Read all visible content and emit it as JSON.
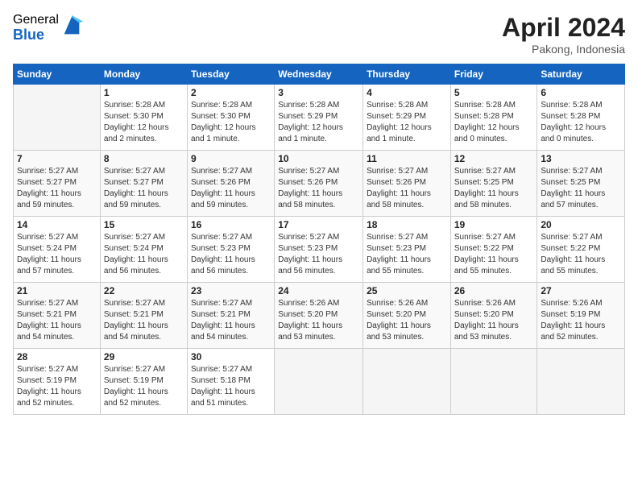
{
  "header": {
    "logo_general": "General",
    "logo_blue": "Blue",
    "month_title": "April 2024",
    "location": "Pakong, Indonesia"
  },
  "days_of_week": [
    "Sunday",
    "Monday",
    "Tuesday",
    "Wednesday",
    "Thursday",
    "Friday",
    "Saturday"
  ],
  "weeks": [
    [
      {
        "day": "",
        "info": ""
      },
      {
        "day": "1",
        "info": "Sunrise: 5:28 AM\nSunset: 5:30 PM\nDaylight: 12 hours\nand 2 minutes."
      },
      {
        "day": "2",
        "info": "Sunrise: 5:28 AM\nSunset: 5:30 PM\nDaylight: 12 hours\nand 1 minute."
      },
      {
        "day": "3",
        "info": "Sunrise: 5:28 AM\nSunset: 5:29 PM\nDaylight: 12 hours\nand 1 minute."
      },
      {
        "day": "4",
        "info": "Sunrise: 5:28 AM\nSunset: 5:29 PM\nDaylight: 12 hours\nand 1 minute."
      },
      {
        "day": "5",
        "info": "Sunrise: 5:28 AM\nSunset: 5:28 PM\nDaylight: 12 hours\nand 0 minutes."
      },
      {
        "day": "6",
        "info": "Sunrise: 5:28 AM\nSunset: 5:28 PM\nDaylight: 12 hours\nand 0 minutes."
      }
    ],
    [
      {
        "day": "7",
        "info": "Sunrise: 5:27 AM\nSunset: 5:27 PM\nDaylight: 11 hours\nand 59 minutes."
      },
      {
        "day": "8",
        "info": "Sunrise: 5:27 AM\nSunset: 5:27 PM\nDaylight: 11 hours\nand 59 minutes."
      },
      {
        "day": "9",
        "info": "Sunrise: 5:27 AM\nSunset: 5:26 PM\nDaylight: 11 hours\nand 59 minutes."
      },
      {
        "day": "10",
        "info": "Sunrise: 5:27 AM\nSunset: 5:26 PM\nDaylight: 11 hours\nand 58 minutes."
      },
      {
        "day": "11",
        "info": "Sunrise: 5:27 AM\nSunset: 5:26 PM\nDaylight: 11 hours\nand 58 minutes."
      },
      {
        "day": "12",
        "info": "Sunrise: 5:27 AM\nSunset: 5:25 PM\nDaylight: 11 hours\nand 58 minutes."
      },
      {
        "day": "13",
        "info": "Sunrise: 5:27 AM\nSunset: 5:25 PM\nDaylight: 11 hours\nand 57 minutes."
      }
    ],
    [
      {
        "day": "14",
        "info": "Sunrise: 5:27 AM\nSunset: 5:24 PM\nDaylight: 11 hours\nand 57 minutes."
      },
      {
        "day": "15",
        "info": "Sunrise: 5:27 AM\nSunset: 5:24 PM\nDaylight: 11 hours\nand 56 minutes."
      },
      {
        "day": "16",
        "info": "Sunrise: 5:27 AM\nSunset: 5:23 PM\nDaylight: 11 hours\nand 56 minutes."
      },
      {
        "day": "17",
        "info": "Sunrise: 5:27 AM\nSunset: 5:23 PM\nDaylight: 11 hours\nand 56 minutes."
      },
      {
        "day": "18",
        "info": "Sunrise: 5:27 AM\nSunset: 5:23 PM\nDaylight: 11 hours\nand 55 minutes."
      },
      {
        "day": "19",
        "info": "Sunrise: 5:27 AM\nSunset: 5:22 PM\nDaylight: 11 hours\nand 55 minutes."
      },
      {
        "day": "20",
        "info": "Sunrise: 5:27 AM\nSunset: 5:22 PM\nDaylight: 11 hours\nand 55 minutes."
      }
    ],
    [
      {
        "day": "21",
        "info": "Sunrise: 5:27 AM\nSunset: 5:21 PM\nDaylight: 11 hours\nand 54 minutes."
      },
      {
        "day": "22",
        "info": "Sunrise: 5:27 AM\nSunset: 5:21 PM\nDaylight: 11 hours\nand 54 minutes."
      },
      {
        "day": "23",
        "info": "Sunrise: 5:27 AM\nSunset: 5:21 PM\nDaylight: 11 hours\nand 54 minutes."
      },
      {
        "day": "24",
        "info": "Sunrise: 5:26 AM\nSunset: 5:20 PM\nDaylight: 11 hours\nand 53 minutes."
      },
      {
        "day": "25",
        "info": "Sunrise: 5:26 AM\nSunset: 5:20 PM\nDaylight: 11 hours\nand 53 minutes."
      },
      {
        "day": "26",
        "info": "Sunrise: 5:26 AM\nSunset: 5:20 PM\nDaylight: 11 hours\nand 53 minutes."
      },
      {
        "day": "27",
        "info": "Sunrise: 5:26 AM\nSunset: 5:19 PM\nDaylight: 11 hours\nand 52 minutes."
      }
    ],
    [
      {
        "day": "28",
        "info": "Sunrise: 5:27 AM\nSunset: 5:19 PM\nDaylight: 11 hours\nand 52 minutes."
      },
      {
        "day": "29",
        "info": "Sunrise: 5:27 AM\nSunset: 5:19 PM\nDaylight: 11 hours\nand 52 minutes."
      },
      {
        "day": "30",
        "info": "Sunrise: 5:27 AM\nSunset: 5:18 PM\nDaylight: 11 hours\nand 51 minutes."
      },
      {
        "day": "",
        "info": ""
      },
      {
        "day": "",
        "info": ""
      },
      {
        "day": "",
        "info": ""
      },
      {
        "day": "",
        "info": ""
      }
    ]
  ]
}
